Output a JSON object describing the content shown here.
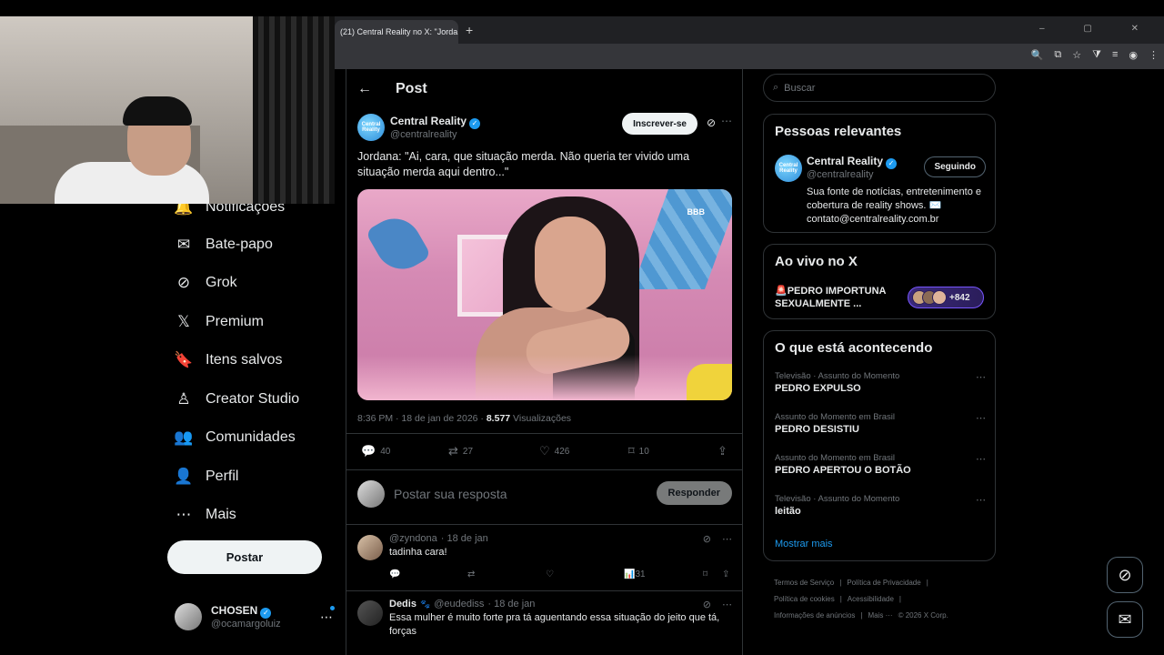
{
  "browser": {
    "tab_title": "(21) Central Reality no X: \"Jorda",
    "tab_close": "×",
    "new_tab": "+",
    "window_controls": "– ▢ ✕"
  },
  "nav": {
    "items": [
      {
        "label": "Notificações",
        "icon": "bell-icon",
        "glyph": "🔔"
      },
      {
        "label": "Bate-papo",
        "icon": "mail-icon",
        "glyph": "✉"
      },
      {
        "label": "Grok",
        "icon": "grok-icon",
        "glyph": "⊘"
      },
      {
        "label": "Premium",
        "icon": "x-logo-icon",
        "glyph": "𝕏"
      },
      {
        "label": "Itens salvos",
        "icon": "bookmark-icon",
        "glyph": "🔖"
      },
      {
        "label": "Creator Studio",
        "icon": "creator-studio-icon",
        "glyph": "♙"
      },
      {
        "label": "Comunidades",
        "icon": "communities-icon",
        "glyph": "👥"
      },
      {
        "label": "Perfil",
        "icon": "profile-icon",
        "glyph": "👤"
      },
      {
        "label": "Mais",
        "icon": "more-circle-icon",
        "glyph": "⋯"
      }
    ],
    "post_button": "Postar",
    "account_name": "CHOSEN",
    "account_handle": "@ocamargoluiz",
    "account_more": "⋯"
  },
  "main": {
    "title": "Post",
    "back": "←",
    "tweet": {
      "avatar_text": "Central Reality",
      "name": "Central Reality",
      "handle": "@centralreality",
      "subscribe": "Inscrever-se",
      "text": "Jordana: \"Ai, cara, que situação merda. Não queria ter vivido uma situação merda aqui dentro...\"",
      "watermark": "BBB",
      "time": "8:36 PM · 18 de jan de 2026 · ",
      "views": "8.577",
      "views_label": " Visualizações",
      "replies": "40",
      "reposts": "27",
      "likes": "426",
      "bookmarks": "10"
    },
    "reply_placeholder": "Postar sua resposta",
    "reply_button": "Responder",
    "replies": [
      {
        "name": "",
        "handle": "@zyndona",
        "date": "· 18 de jan",
        "text": "tadinha cara!",
        "views": "31"
      },
      {
        "name": "Dedis",
        "emoji": "🐾",
        "handle": "@eudediss",
        "date": "· 18 de jan",
        "text": "Essa mulher é muito forte pra tá aguentando essa situação do jeito que tá, forças"
      }
    ]
  },
  "right": {
    "search_placeholder": "Buscar",
    "relevant": {
      "title": "Pessoas relevantes",
      "name": "Central Reality",
      "handle": "@centralreality",
      "follow": "Seguindo",
      "bio": "Sua fonte de notícias, entretenimento e cobertura de reality shows. ✉️ contato@centralreality.com.br"
    },
    "live": {
      "title": "Ao vivo no X",
      "text": "🚨PEDRO IMPORTUNA SEXUALMENTE ...",
      "count": "+842"
    },
    "trends": {
      "title": "O que está acontecendo",
      "items": [
        {
          "category": "Televisão · Assunto do Momento",
          "term": "PEDRO EXPULSO"
        },
        {
          "category": "Assunto do Momento em Brasil",
          "term": "PEDRO DESISTIU"
        },
        {
          "category": "Assunto do Momento em Brasil",
          "term": "PEDRO APERTOU O BOTÃO"
        },
        {
          "category": "Televisão · Assunto do Momento",
          "term": "leitão"
        }
      ],
      "show_more": "Mostrar mais"
    },
    "footer": [
      "Termos de Serviço",
      "|",
      "Política de Privacidade",
      "|",
      "Política de cookies",
      "|",
      "Acessibilidade",
      "|",
      "Informações de anúncios",
      "|",
      "Mais ···",
      "© 2026 X Corp."
    ]
  },
  "colors": {
    "accent": "#1d9bf0",
    "bg": "#000000",
    "border": "#2f3336",
    "muted": "#71767b"
  }
}
